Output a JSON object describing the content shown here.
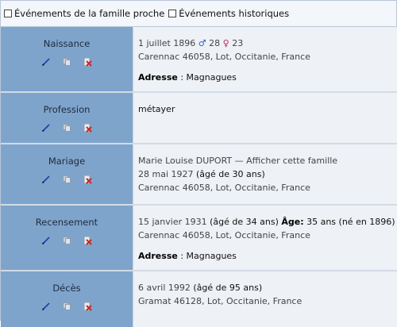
{
  "filters": {
    "family_label": "Événements de la famille proche",
    "historic_label": "Événements historiques"
  },
  "events": [
    {
      "label": "Naissance",
      "date": "1 juillet 1896",
      "male_symbol": "♂",
      "father_age": "28",
      "female_symbol": "♀",
      "mother_age": "23",
      "place": "Carennac 46058, Lot, Occitanie, France",
      "address_label": "Adresse",
      "address_sep": " : ",
      "address": "Magnagues"
    },
    {
      "label": "Profession",
      "value": "métayer"
    },
    {
      "label": "Mariage",
      "spouse": "Marie Louise DUPORT",
      "family_link": " — Afficher cette famille",
      "date": "28 mai 1927",
      "age": " (âgé de 30 ans)",
      "place": "Carennac 46058, Lot, Occitanie, France"
    },
    {
      "label": "Recensement",
      "date": "15 janvier 1931",
      "age": " (âgé de 34 ans) ",
      "age_label": "Âge:",
      "age_value": " 35 ans (né en 1896)",
      "place": "Carennac 46058, Lot, Occitanie, France",
      "address_label": "Adresse",
      "address_sep": " : ",
      "address": "Magnagues"
    },
    {
      "label": "Décès",
      "date": "6 avril 1992",
      "age": " (âgé de 95 ans)",
      "place": "Gramat 46128, Lot, Occitanie, France"
    }
  ],
  "icons": {
    "edit": "pencil-icon",
    "copy": "copy-icon",
    "delete": "delete-icon",
    "colors": {
      "edit": "#1c3fa8",
      "copy": "#8e9bab",
      "delete": "#c62828"
    }
  }
}
